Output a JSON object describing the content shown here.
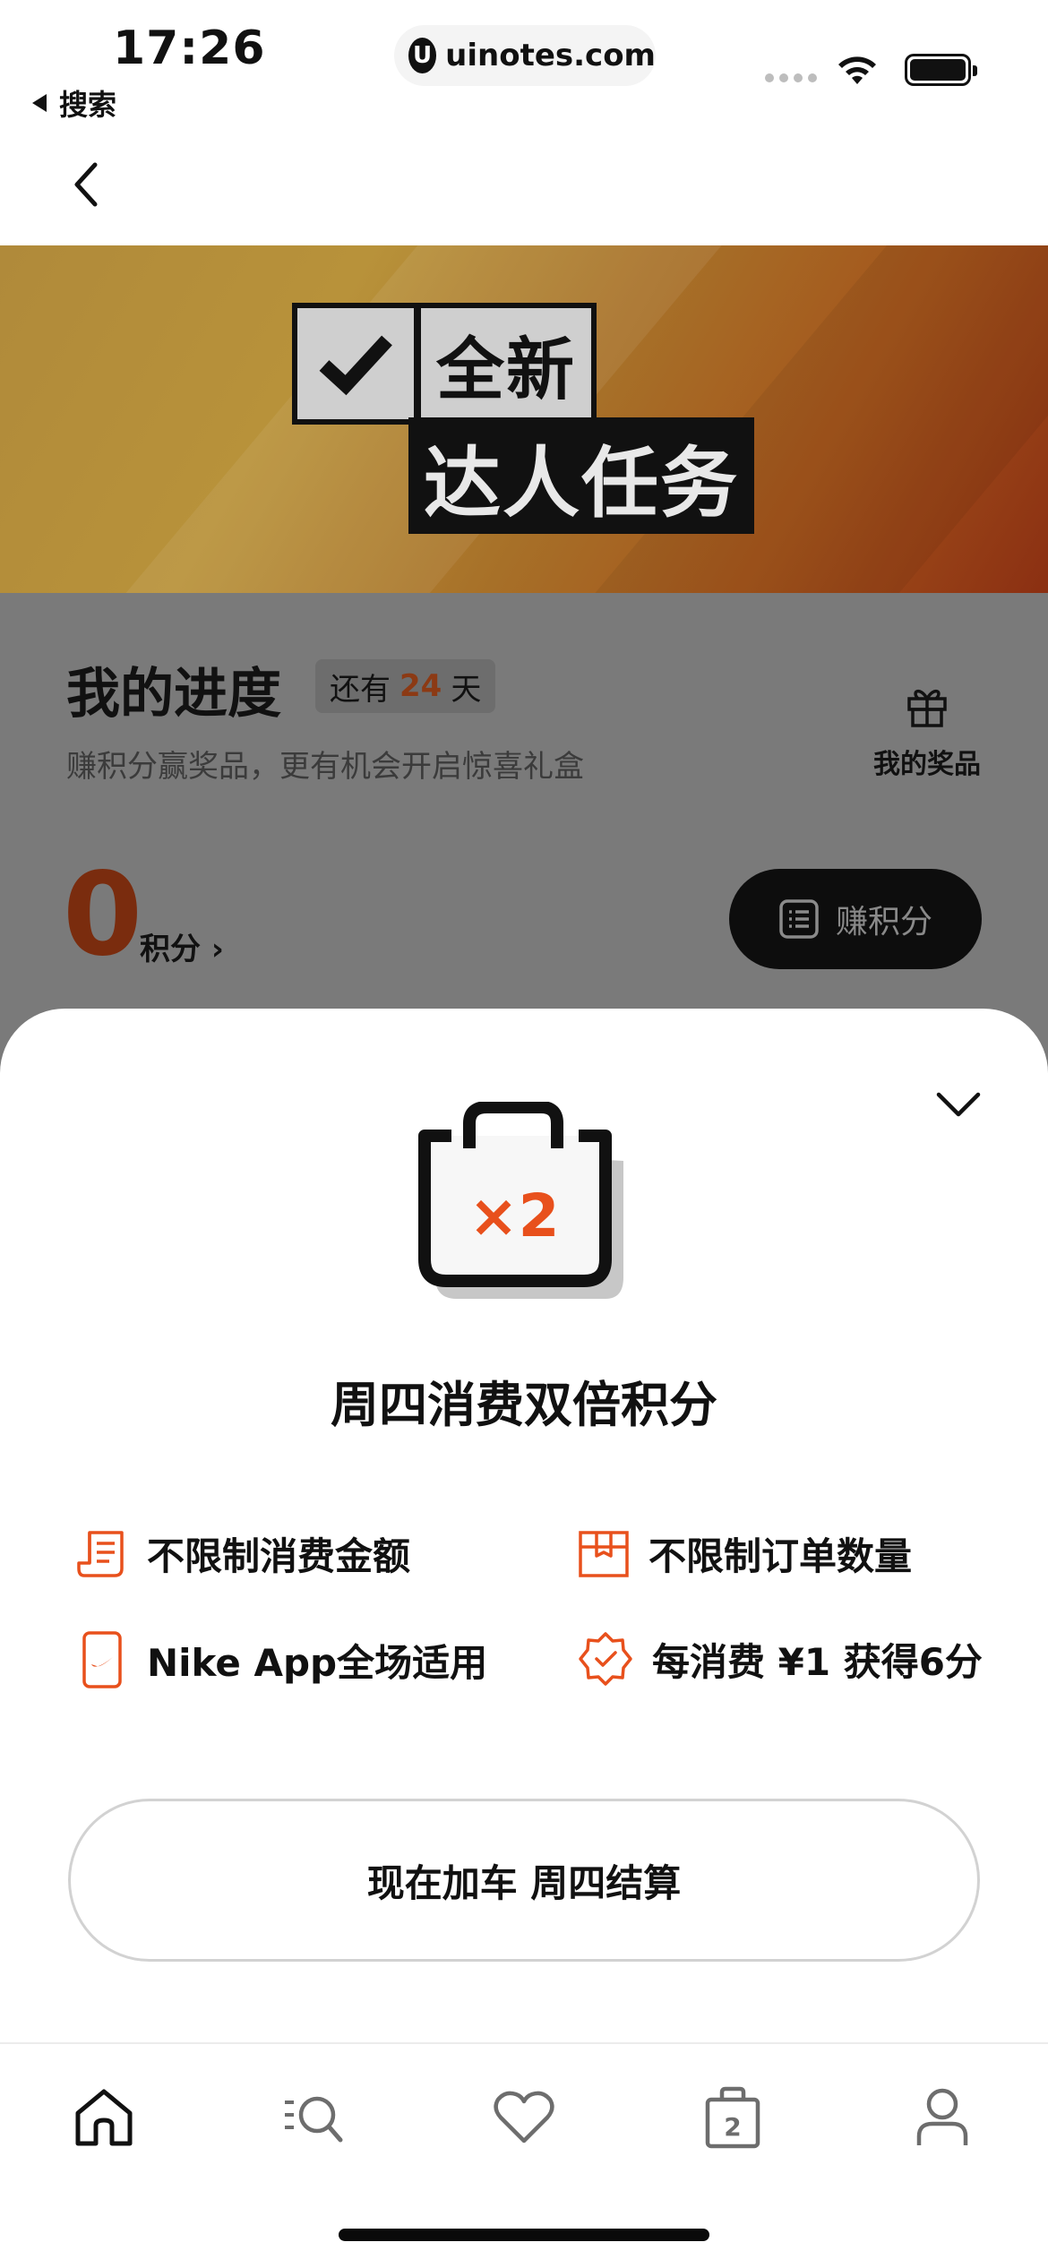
{
  "status_bar": {
    "time": "17:26",
    "back_app": "搜索",
    "url": "uinotes.com",
    "url_logo": "U",
    "icons": [
      "wifi-icon",
      "battery-icon"
    ]
  },
  "hero": {
    "line1": "全新",
    "line2": "达人任务"
  },
  "progress": {
    "title": "我的进度",
    "days_prefix": "还有",
    "days_value": "24",
    "days_suffix": "天",
    "subtitle": "赚积分赢奖品，更有机会开启惊喜礼盒",
    "prize_label": "我的奖品",
    "points": "0",
    "points_label": "积分 ›",
    "earn_button": "赚积分"
  },
  "sheet": {
    "badge": "×2",
    "title": "周四消费双倍积分",
    "features": [
      {
        "icon": "receipt-icon",
        "label": "不限制消费金额"
      },
      {
        "icon": "box-icon",
        "label": "不限制订单数量"
      },
      {
        "icon": "phone-swoosh-icon",
        "label": "Nike App全场适用"
      },
      {
        "icon": "badge-check-icon",
        "label": "每消费 ¥1 获得6分"
      }
    ],
    "cta": "现在加车 周四结算"
  },
  "tab_bar": {
    "bag_count": "2",
    "tabs": [
      "home-icon",
      "search-list-icon",
      "heart-icon",
      "bag-icon",
      "profile-icon"
    ]
  },
  "colors": {
    "accent_orange": "#e8501c",
    "dim_overlay": "#7a7a7a"
  }
}
